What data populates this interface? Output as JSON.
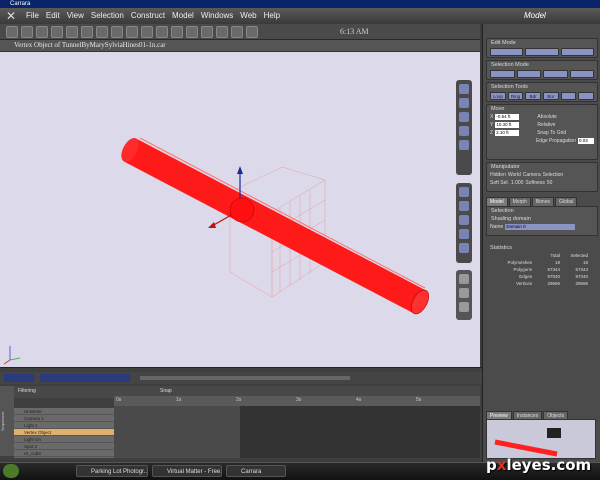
{
  "window": {
    "title": "Carrara",
    "mode": "Model"
  },
  "menu": [
    "File",
    "Edit",
    "View",
    "Selection",
    "Construct",
    "Model",
    "Windows",
    "Web",
    "Help"
  ],
  "clock": "6:13 AM",
  "document": {
    "title": "Vertex Object of TunnelByMarySylviaHines01-1n.car"
  },
  "right_panel": {
    "edit_mode": "Edit Mode",
    "selection_mode": "Selection Mode",
    "selection_tools": "Selection Tools",
    "tools": [
      "Loop",
      "Ring",
      "Bdr",
      "Bor"
    ],
    "move": "Move",
    "x": "-0.54 ft",
    "y": "10.30 ft",
    "z": "2.10 ft",
    "absolute": "Absolute",
    "relative": "Relative",
    "snap_to_grid": "Snap To Grid",
    "edge_propagation": "Edge Propagation",
    "edge_prop_value": "0.03",
    "manipulator": "Manipulator",
    "hidden": "Hidden",
    "world": "World",
    "camera": "Camera",
    "selection": "Selection",
    "soft_sel": "Soft Sel.",
    "soft_value": "1.000",
    "softness": "Softness",
    "softness_value": "50"
  },
  "tabs": [
    "Model",
    "Morph",
    "Bones",
    "Global"
  ],
  "selection_panel": {
    "header": "Selection",
    "shading_domain": "Shading domain",
    "name_label": "Name",
    "name_value": "Domain 0"
  },
  "statistics": {
    "header": "Statistics",
    "cols": [
      "Total",
      "Selected"
    ],
    "rows": [
      {
        "label": "Polymeshes",
        "total": "18",
        "selected": "18"
      },
      {
        "label": "Polygons",
        "total": "57344",
        "selected": "57344"
      },
      {
        "label": "Edges",
        "total": "87040",
        "selected": "87040"
      },
      {
        "label": "Vertices",
        "total": "29696",
        "selected": "29696"
      }
    ]
  },
  "preview_tabs": [
    "Preview",
    "Instances",
    "Objects"
  ],
  "timeline": {
    "sequencer": "Sequencer",
    "filtering": "Filtering",
    "snap": "Snap",
    "ruler": [
      "0s",
      "1s",
      "2s",
      "3s",
      "4s",
      "5s"
    ],
    "tracks": [
      "Universe",
      "Camera 1",
      "Light 1",
      "Vertex Object",
      "Light On",
      "Spot 2",
      "UI_cub3"
    ]
  },
  "taskbar": [
    "Parking Lot Photogr...",
    "Virtual Matter - Free...",
    "Carrara"
  ],
  "watermark": {
    "a": "p",
    "x": "x",
    "b": "leyes.com"
  }
}
